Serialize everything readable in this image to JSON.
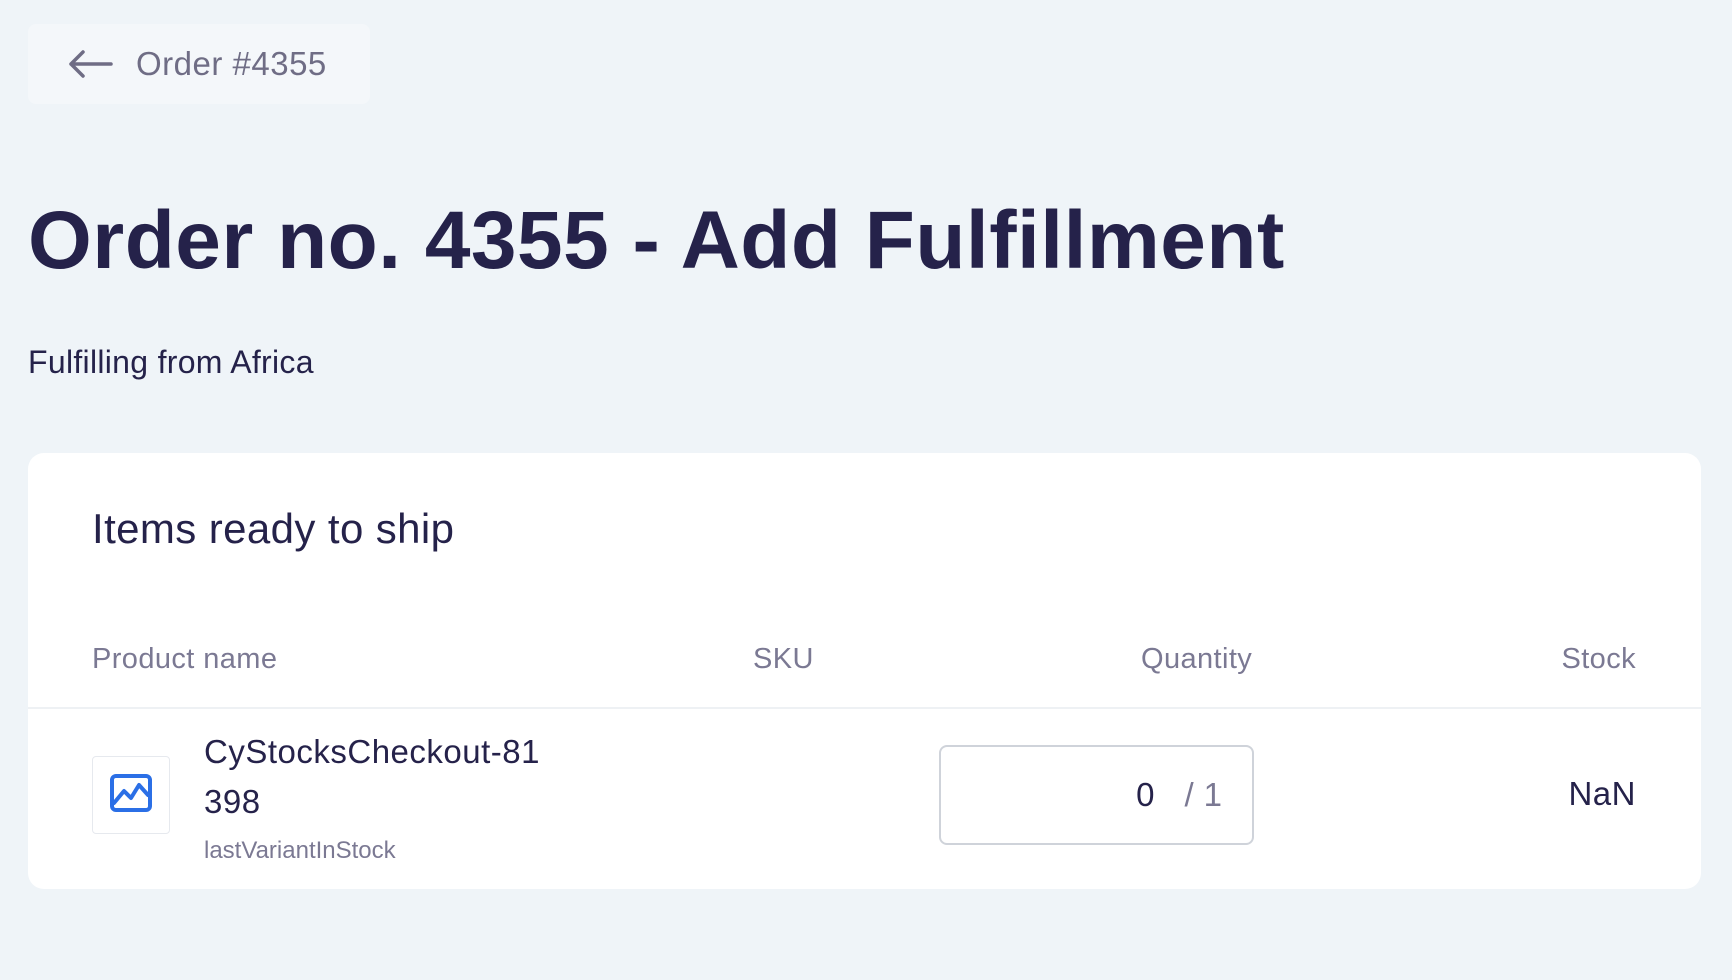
{
  "header": {
    "back_label": "Order #4355",
    "title": "Order no. 4355 - Add Fulfillment",
    "subtitle": "Fulfilling from Africa"
  },
  "card": {
    "title": "Items ready to ship",
    "columns": {
      "product_name": "Product name",
      "sku": "SKU",
      "quantity": "Quantity",
      "stock": "Stock"
    },
    "rows": [
      {
        "product_name": "CyStocksCheckout-81398",
        "variant": "lastVariantInStock",
        "sku": "",
        "quantity_value": "0",
        "quantity_separator": "/",
        "quantity_total": "1",
        "stock": "NaN"
      }
    ]
  },
  "icons": {
    "back": "arrow-left-icon",
    "thumbnail": "image-placeholder-icon"
  },
  "colors": {
    "background": "#eff4f8",
    "text_primary": "#25224a",
    "text_secondary": "#7b7993",
    "accent_icon": "#2b6fe6",
    "card": "#ffffff"
  }
}
